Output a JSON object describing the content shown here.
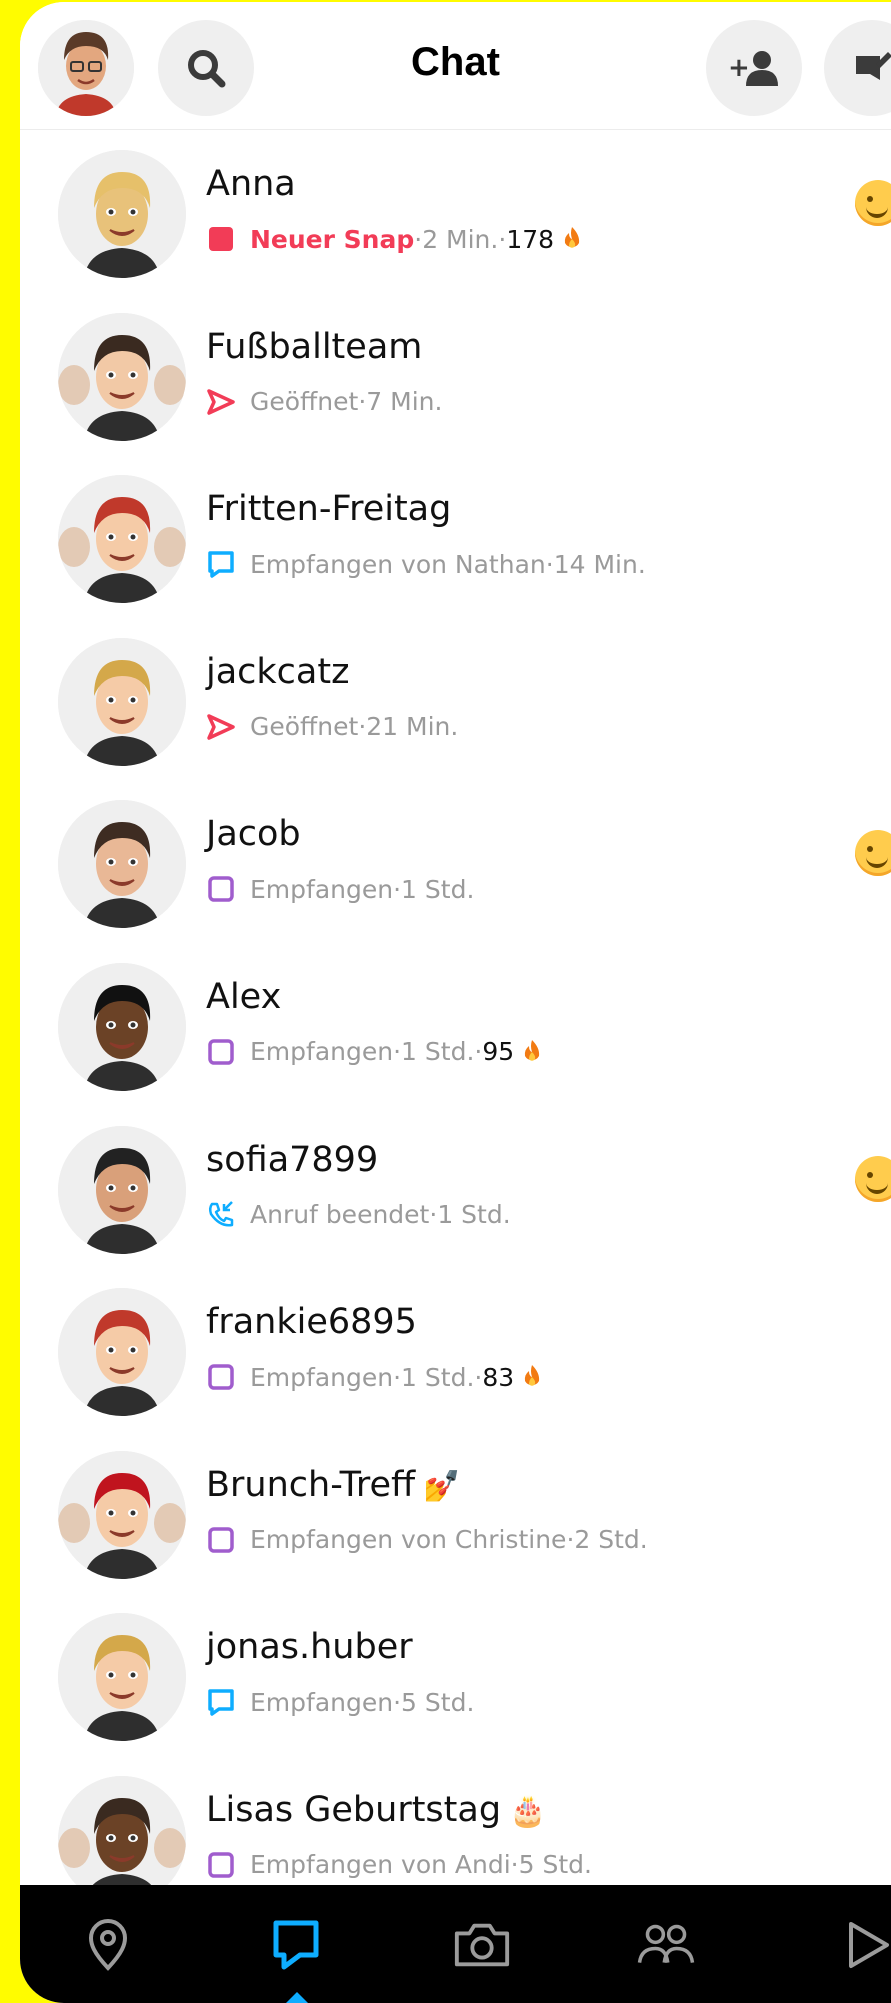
{
  "header": {
    "title": "Chat"
  },
  "chats": [
    {
      "name": "Anna",
      "status": "Neuer Snap",
      "status_style": "new-snap",
      "time": "2 Min.",
      "streak": "178",
      "name_emoji": "",
      "show_smiley": true,
      "avatar_color": "#E8C27A",
      "hair_color": "#E6C06A",
      "group": false
    },
    {
      "name": "Fußballteam",
      "status": "Geöffnet",
      "status_style": "opened",
      "time": "7 Min.",
      "streak": "",
      "name_emoji": "",
      "show_smiley": false,
      "avatar_color": "#F2C9A6",
      "hair_color": "#3A2A20",
      "group": true
    },
    {
      "name": "Fritten-Freitag",
      "status": "Empfangen von Nathan",
      "status_style": "chat-received",
      "time": "14 Min.",
      "streak": "",
      "name_emoji": "",
      "show_smiley": false,
      "avatar_color": "#F5CBA7",
      "hair_color": "#C0392B",
      "group": true
    },
    {
      "name": "jackcatz",
      "status": "Geöffnet",
      "status_style": "opened",
      "time": "21 Min.",
      "streak": "",
      "name_emoji": "",
      "show_smiley": false,
      "avatar_color": "#F5CBA7",
      "hair_color": "#D4A84A",
      "group": false
    },
    {
      "name": "Jacob",
      "status": "Empfangen",
      "status_style": "received",
      "time": "1 Std.",
      "streak": "",
      "name_emoji": "",
      "show_smiley": true,
      "avatar_color": "#E9B896",
      "hair_color": "#3E2C22",
      "group": false
    },
    {
      "name": "Alex",
      "status": "Empfangen",
      "status_style": "received",
      "time": "1 Std.",
      "streak": "95",
      "name_emoji": "",
      "show_smiley": false,
      "avatar_color": "#6B4226",
      "hair_color": "#111111",
      "group": false
    },
    {
      "name": "sofia7899",
      "status": "Anruf beendet",
      "status_style": "call",
      "time": "1 Std.",
      "streak": "",
      "name_emoji": "",
      "show_smiley": true,
      "avatar_color": "#D9A07A",
      "hair_color": "#222222",
      "group": false
    },
    {
      "name": "frankie6895",
      "status": "Empfangen",
      "status_style": "received",
      "time": "1 Std.",
      "streak": "83",
      "name_emoji": "",
      "show_smiley": false,
      "avatar_color": "#F5CBA7",
      "hair_color": "#C0392B",
      "group": false
    },
    {
      "name": "Brunch-Treff",
      "status": "Empfangen von Christine",
      "status_style": "received",
      "time": "2 Std.",
      "streak": "",
      "name_emoji": "💅",
      "show_smiley": false,
      "avatar_color": "#F5CBA7",
      "hair_color": "#C0141E",
      "group": true
    },
    {
      "name": "jonas.huber",
      "status": "Empfangen",
      "status_style": "chat-received",
      "time": "5 Std.",
      "streak": "",
      "name_emoji": "",
      "show_smiley": false,
      "avatar_color": "#F5CBA7",
      "hair_color": "#D4A84A",
      "group": false
    },
    {
      "name": "Lisas Geburtstag",
      "status": "Empfangen von Andi",
      "status_style": "received",
      "time": "5 Std.",
      "streak": "",
      "name_emoji": "🎂",
      "show_smiley": false,
      "avatar_color": "#6B4226",
      "hair_color": "#3A2A20",
      "group": true
    }
  ],
  "status_colors": {
    "new_snap": "#F23C57",
    "chat_blue": "#0EADFF",
    "received_purple": "#A05DCD",
    "opened_red": "#F23C57"
  },
  "nav": [
    {
      "icon": "map-pin-icon"
    },
    {
      "icon": "chat-icon",
      "active": true
    },
    {
      "icon": "camera-icon"
    },
    {
      "icon": "friends-icon"
    },
    {
      "icon": "play-icon"
    }
  ]
}
